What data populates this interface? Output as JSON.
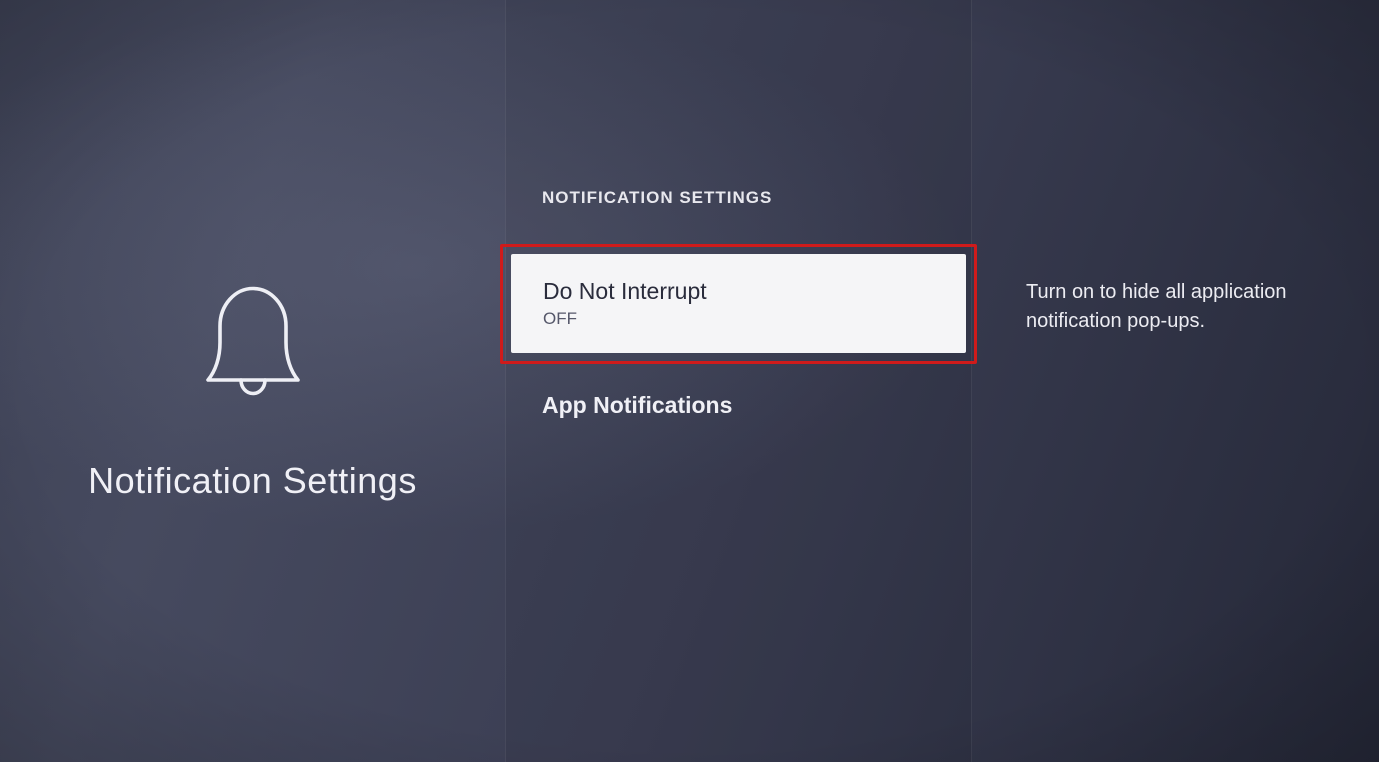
{
  "left": {
    "title": "Notification Settings"
  },
  "center": {
    "section_header": "NOTIFICATION SETTINGS",
    "items": [
      {
        "title": "Do Not Interrupt",
        "value": "OFF"
      },
      {
        "title": "App Notifications"
      }
    ]
  },
  "right": {
    "description": "Turn on to hide all application notification pop-ups."
  }
}
